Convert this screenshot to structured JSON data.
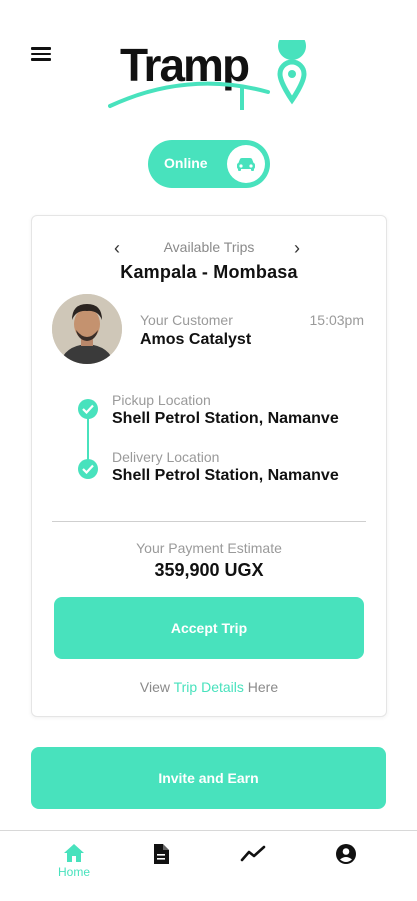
{
  "header": {
    "menu_icon": "hamburger-menu-icon",
    "logo_text": "Tramp"
  },
  "status": {
    "label": "Online",
    "icon": "car-icon",
    "accent": "#48e2bd"
  },
  "trip_card": {
    "section_label": "Available  Trips",
    "prev_icon": "chevron-left-icon",
    "next_icon": "chevron-right-icon",
    "prev_glyph": "‹",
    "next_glyph": "›",
    "route": "Kampala - Mombasa",
    "customer": {
      "label": "Your Customer",
      "name": "Amos Catalyst",
      "time": "15:03pm"
    },
    "pickup": {
      "label": "Pickup Location",
      "value": "Shell Petrol Station, Namanve"
    },
    "delivery": {
      "label": "Delivery Location",
      "value": "Shell Petrol Station, Namanve"
    },
    "estimate": {
      "label": "Your Payment Estimate",
      "value": "359,900 UGX"
    },
    "accept_label": "Accept Trip",
    "details": {
      "prefix": "View ",
      "link": "Trip Details",
      "suffix": " Here"
    }
  },
  "invite_label": "Invite and Earn",
  "bottom_nav": {
    "home_label": "Home",
    "items": [
      "home-icon",
      "document-icon",
      "trending-icon",
      "account-circle-icon"
    ]
  },
  "colors": {
    "accent": "#48e2bd",
    "text_primary": "#111111",
    "text_muted": "#9a9a9a"
  }
}
